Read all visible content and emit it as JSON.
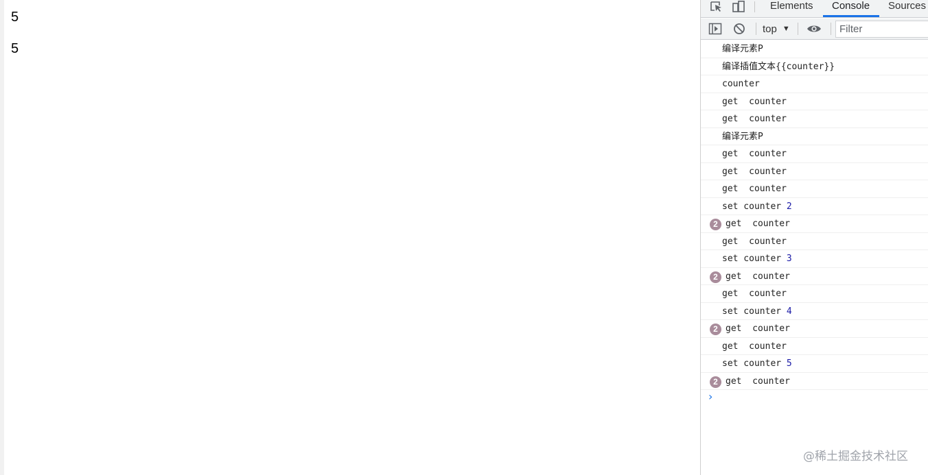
{
  "page": {
    "lines": [
      "5",
      "5"
    ]
  },
  "devtools": {
    "tabs": [
      "Elements",
      "Console",
      "Sources"
    ],
    "active_tab": "Console",
    "toolbar": {
      "context": "top",
      "filter_placeholder": "Filter"
    },
    "console_messages": [
      {
        "text": "编译元素P",
        "count": null,
        "value": null
      },
      {
        "text": "编译插值文本{{counter}}",
        "count": null,
        "value": null
      },
      {
        "text": "counter",
        "count": null,
        "value": null
      },
      {
        "text": "get  counter",
        "count": null,
        "value": null
      },
      {
        "text": "get  counter",
        "count": null,
        "value": null
      },
      {
        "text": "编译元素P",
        "count": null,
        "value": null
      },
      {
        "text": "get  counter",
        "count": null,
        "value": null
      },
      {
        "text": "get  counter",
        "count": null,
        "value": null
      },
      {
        "text": "get  counter",
        "count": null,
        "value": null
      },
      {
        "text": "set counter ",
        "count": null,
        "value": "2"
      },
      {
        "text": "get  counter",
        "count": "2",
        "value": null
      },
      {
        "text": "get  counter",
        "count": null,
        "value": null
      },
      {
        "text": "set counter ",
        "count": null,
        "value": "3"
      },
      {
        "text": "get  counter",
        "count": "2",
        "value": null
      },
      {
        "text": "get  counter",
        "count": null,
        "value": null
      },
      {
        "text": "set counter ",
        "count": null,
        "value": "4"
      },
      {
        "text": "get  counter",
        "count": "2",
        "value": null
      },
      {
        "text": "get  counter",
        "count": null,
        "value": null
      },
      {
        "text": "set counter ",
        "count": null,
        "value": "5"
      },
      {
        "text": "get  counter",
        "count": "2",
        "value": null
      }
    ],
    "prompt_symbol": "›"
  },
  "watermark": "@稀土掘金技术社区",
  "colors": {
    "tab_underline": "#1a73e8",
    "badge": "#a98c9b",
    "number": "#1a1aa6"
  }
}
